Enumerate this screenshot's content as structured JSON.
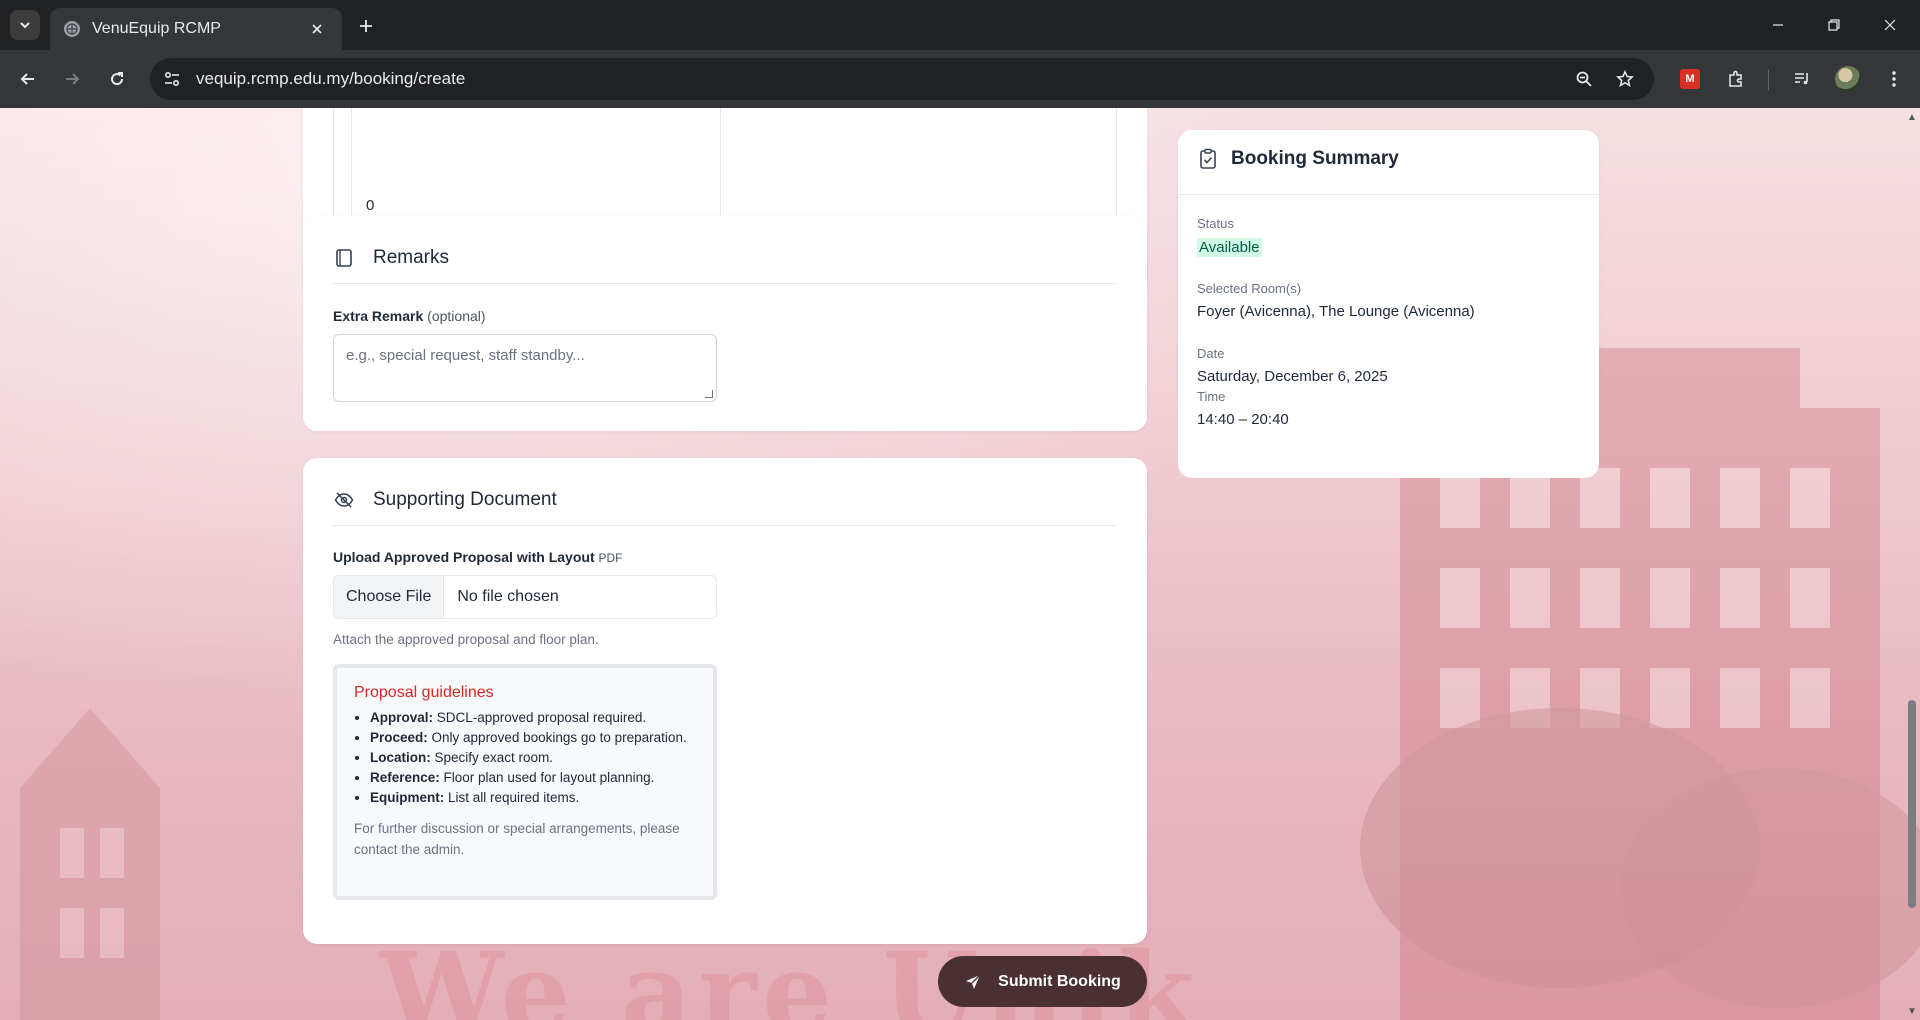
{
  "browser": {
    "tab_title": "VenuEquip RCMP",
    "url": "vequip.rcmp.edu.my/booking/create"
  },
  "prev_card": {
    "number_value": "0"
  },
  "remarks": {
    "title": "Remarks",
    "label": "Extra Remark",
    "label_optional": "(optional)",
    "placeholder": "e.g., special request, staff standby..."
  },
  "supporting": {
    "title": "Supporting Document",
    "label": "Upload Approved Proposal with Layout",
    "label_format": "PDF",
    "choose_file": "Choose File",
    "no_file": "No file chosen",
    "hint": "Attach the approved proposal and floor plan.",
    "guidelines_title": "Proposal guidelines",
    "guidelines": [
      {
        "key": "Approval:",
        "text": " SDCL-approved proposal required."
      },
      {
        "key": "Proceed:",
        "text": " Only approved bookings go to preparation."
      },
      {
        "key": "Location:",
        "text": " Specify exact room."
      },
      {
        "key": "Reference:",
        "text": " Floor plan used for layout planning."
      },
      {
        "key": "Equipment:",
        "text": " List all required items."
      }
    ],
    "note": "For further discussion or special arrangements, please contact the admin."
  },
  "summary": {
    "title": "Booking Summary",
    "status_label": "Status",
    "status_value": "Available",
    "rooms_label": "Selected Room(s)",
    "rooms_value": "Foyer (Avicenna), The Lounge (Avicenna)",
    "date_label": "Date",
    "date_value": "Saturday, December 6, 2025",
    "time_label": "Time",
    "time_value": "14:40 – 20:40"
  },
  "submit_label": "Submit Booking",
  "icons": {
    "tab_list": "chevron-down-icon",
    "favicon": "globe-icon",
    "remarks": "square-icon",
    "supporting": "eye-off-icon",
    "summary": "clipboard-check-icon",
    "submit": "send-icon"
  },
  "colors": {
    "accent_red": "#dc2626",
    "status_green_bg": "#d1fae5",
    "submit_bg": "#4a2f33"
  }
}
